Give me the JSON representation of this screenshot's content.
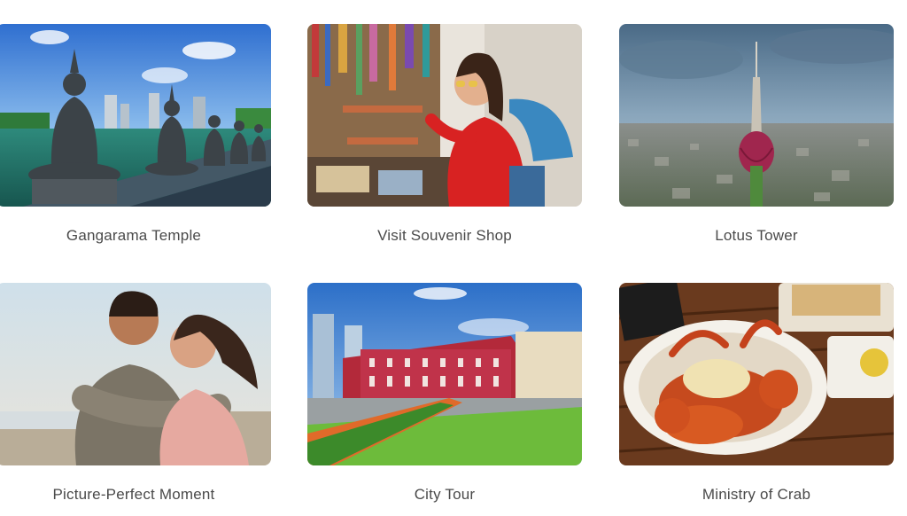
{
  "attractions": [
    {
      "title": "Gangarama Temple",
      "image": "buddha-statues-lake-photo"
    },
    {
      "title": "Visit Souvenir Shop",
      "image": "souvenir-shop-woman-photo"
    },
    {
      "title": "Lotus Tower",
      "image": "lotus-tower-aerial-photo"
    },
    {
      "title": "Picture-Perfect Moment",
      "image": "couple-beach-photo"
    },
    {
      "title": "City Tour",
      "image": "colombo-red-building-photo"
    },
    {
      "title": "Ministry of Crab",
      "image": "crab-dish-photo"
    }
  ]
}
